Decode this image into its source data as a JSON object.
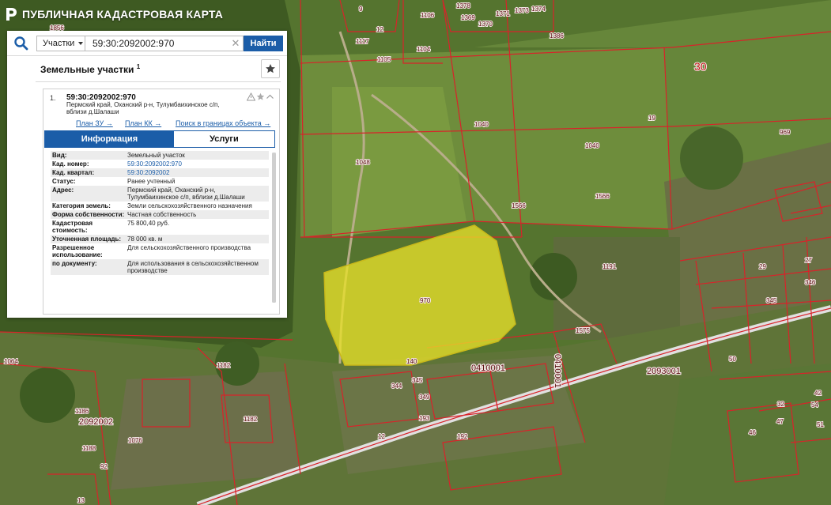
{
  "app": {
    "title": "ПУБЛИЧНАЯ КАДАСТРОВАЯ КАРТА"
  },
  "search": {
    "type_label": "Участки",
    "value": "59:30:2092002:970",
    "button_label": "Найти"
  },
  "results": {
    "section_title": "Земельные участки",
    "count": "1",
    "item": {
      "number": "1.",
      "cadastral_number": "59:30:2092002:970",
      "address": "Пермский край, Оханский р-н, Тулумбаихинское с/п, вблизи д.Шалаши",
      "links": {
        "plan_zu": "План ЗУ →",
        "plan_kk": "План КК →",
        "search_in_bounds": "Поиск в границах объекта →"
      },
      "tabs": {
        "info": "Информация",
        "services": "Услуги"
      },
      "rows": [
        {
          "key": "Вид:",
          "value": "Земельный участок"
        },
        {
          "key": "Кад. номер:",
          "value": "59:30:2092002:970"
        },
        {
          "key": "Кад. квартал:",
          "value": "59:30:2092002"
        },
        {
          "key": "Статус:",
          "value": "Ранее учтенный"
        },
        {
          "key": "Адрес:",
          "value": "Пермский край, Оханский р-н, Тулумбаихинское с/п, вблизи д.Шалаши"
        },
        {
          "key": "Категория земель:",
          "value": "Земли сельскохозяйственного назначения"
        },
        {
          "key": "Форма собственности:",
          "value": "Частная собственность"
        },
        {
          "key": "Кадастровая стоимость:",
          "value": "75 800,40 руб."
        },
        {
          "key": "Уточненная площадь:",
          "value": "78 000 кв. м"
        },
        {
          "key": "Разрешенное использование:",
          "value": "Для сельскохозяйственного производства"
        },
        {
          "key": "по документу:",
          "value": "Для использования в сельскохозяйственном производстве"
        }
      ]
    }
  },
  "map": {
    "selected_parcel_label": "970",
    "selected_parcel_color": "#e8e02a",
    "boundary_color": "#d8232a",
    "district_label": "30",
    "quarter_labels": [
      "2092002",
      "2093001",
      "0410001",
      "0410001"
    ],
    "parcel_labels": [
      "9",
      "12",
      "1106",
      "1104",
      "1105",
      "1117",
      "1369",
      "1370",
      "1371",
      "1373",
      "1374",
      "1378",
      "1386",
      "1856",
      "1040",
      "1040",
      "1048",
      "1566",
      "1566",
      "19",
      "969",
      "1191",
      "1575",
      "1064",
      "1182",
      "1182",
      "1186",
      "1076",
      "1188",
      "92",
      "13",
      "140",
      "344",
      "345",
      "349",
      "193",
      "192",
      "12",
      "32",
      "42",
      "46",
      "47",
      "50",
      "51",
      "54",
      "27",
      "29",
      "345",
      "346"
    ]
  }
}
